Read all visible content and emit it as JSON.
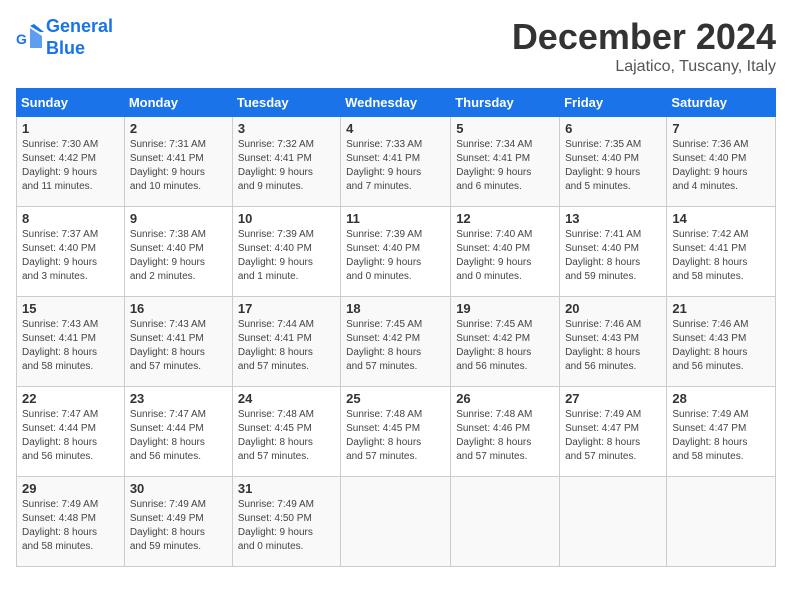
{
  "header": {
    "logo_line1": "General",
    "logo_line2": "Blue",
    "month_title": "December 2024",
    "location": "Lajatico, Tuscany, Italy"
  },
  "weekdays": [
    "Sunday",
    "Monday",
    "Tuesday",
    "Wednesday",
    "Thursday",
    "Friday",
    "Saturday"
  ],
  "weeks": [
    [
      {
        "day": "1",
        "info": "Sunrise: 7:30 AM\nSunset: 4:42 PM\nDaylight: 9 hours\nand 11 minutes."
      },
      {
        "day": "2",
        "info": "Sunrise: 7:31 AM\nSunset: 4:41 PM\nDaylight: 9 hours\nand 10 minutes."
      },
      {
        "day": "3",
        "info": "Sunrise: 7:32 AM\nSunset: 4:41 PM\nDaylight: 9 hours\nand 9 minutes."
      },
      {
        "day": "4",
        "info": "Sunrise: 7:33 AM\nSunset: 4:41 PM\nDaylight: 9 hours\nand 7 minutes."
      },
      {
        "day": "5",
        "info": "Sunrise: 7:34 AM\nSunset: 4:41 PM\nDaylight: 9 hours\nand 6 minutes."
      },
      {
        "day": "6",
        "info": "Sunrise: 7:35 AM\nSunset: 4:40 PM\nDaylight: 9 hours\nand 5 minutes."
      },
      {
        "day": "7",
        "info": "Sunrise: 7:36 AM\nSunset: 4:40 PM\nDaylight: 9 hours\nand 4 minutes."
      }
    ],
    [
      {
        "day": "8",
        "info": "Sunrise: 7:37 AM\nSunset: 4:40 PM\nDaylight: 9 hours\nand 3 minutes."
      },
      {
        "day": "9",
        "info": "Sunrise: 7:38 AM\nSunset: 4:40 PM\nDaylight: 9 hours\nand 2 minutes."
      },
      {
        "day": "10",
        "info": "Sunrise: 7:39 AM\nSunset: 4:40 PM\nDaylight: 9 hours\nand 1 minute."
      },
      {
        "day": "11",
        "info": "Sunrise: 7:39 AM\nSunset: 4:40 PM\nDaylight: 9 hours\nand 0 minutes."
      },
      {
        "day": "12",
        "info": "Sunrise: 7:40 AM\nSunset: 4:40 PM\nDaylight: 9 hours\nand 0 minutes."
      },
      {
        "day": "13",
        "info": "Sunrise: 7:41 AM\nSunset: 4:40 PM\nDaylight: 8 hours\nand 59 minutes."
      },
      {
        "day": "14",
        "info": "Sunrise: 7:42 AM\nSunset: 4:41 PM\nDaylight: 8 hours\nand 58 minutes."
      }
    ],
    [
      {
        "day": "15",
        "info": "Sunrise: 7:43 AM\nSunset: 4:41 PM\nDaylight: 8 hours\nand 58 minutes."
      },
      {
        "day": "16",
        "info": "Sunrise: 7:43 AM\nSunset: 4:41 PM\nDaylight: 8 hours\nand 57 minutes."
      },
      {
        "day": "17",
        "info": "Sunrise: 7:44 AM\nSunset: 4:41 PM\nDaylight: 8 hours\nand 57 minutes."
      },
      {
        "day": "18",
        "info": "Sunrise: 7:45 AM\nSunset: 4:42 PM\nDaylight: 8 hours\nand 57 minutes."
      },
      {
        "day": "19",
        "info": "Sunrise: 7:45 AM\nSunset: 4:42 PM\nDaylight: 8 hours\nand 56 minutes."
      },
      {
        "day": "20",
        "info": "Sunrise: 7:46 AM\nSunset: 4:43 PM\nDaylight: 8 hours\nand 56 minutes."
      },
      {
        "day": "21",
        "info": "Sunrise: 7:46 AM\nSunset: 4:43 PM\nDaylight: 8 hours\nand 56 minutes."
      }
    ],
    [
      {
        "day": "22",
        "info": "Sunrise: 7:47 AM\nSunset: 4:44 PM\nDaylight: 8 hours\nand 56 minutes."
      },
      {
        "day": "23",
        "info": "Sunrise: 7:47 AM\nSunset: 4:44 PM\nDaylight: 8 hours\nand 56 minutes."
      },
      {
        "day": "24",
        "info": "Sunrise: 7:48 AM\nSunset: 4:45 PM\nDaylight: 8 hours\nand 57 minutes."
      },
      {
        "day": "25",
        "info": "Sunrise: 7:48 AM\nSunset: 4:45 PM\nDaylight: 8 hours\nand 57 minutes."
      },
      {
        "day": "26",
        "info": "Sunrise: 7:48 AM\nSunset: 4:46 PM\nDaylight: 8 hours\nand 57 minutes."
      },
      {
        "day": "27",
        "info": "Sunrise: 7:49 AM\nSunset: 4:47 PM\nDaylight: 8 hours\nand 57 minutes."
      },
      {
        "day": "28",
        "info": "Sunrise: 7:49 AM\nSunset: 4:47 PM\nDaylight: 8 hours\nand 58 minutes."
      }
    ],
    [
      {
        "day": "29",
        "info": "Sunrise: 7:49 AM\nSunset: 4:48 PM\nDaylight: 8 hours\nand 58 minutes."
      },
      {
        "day": "30",
        "info": "Sunrise: 7:49 AM\nSunset: 4:49 PM\nDaylight: 8 hours\nand 59 minutes."
      },
      {
        "day": "31",
        "info": "Sunrise: 7:49 AM\nSunset: 4:50 PM\nDaylight: 9 hours\nand 0 minutes."
      },
      null,
      null,
      null,
      null
    ]
  ]
}
